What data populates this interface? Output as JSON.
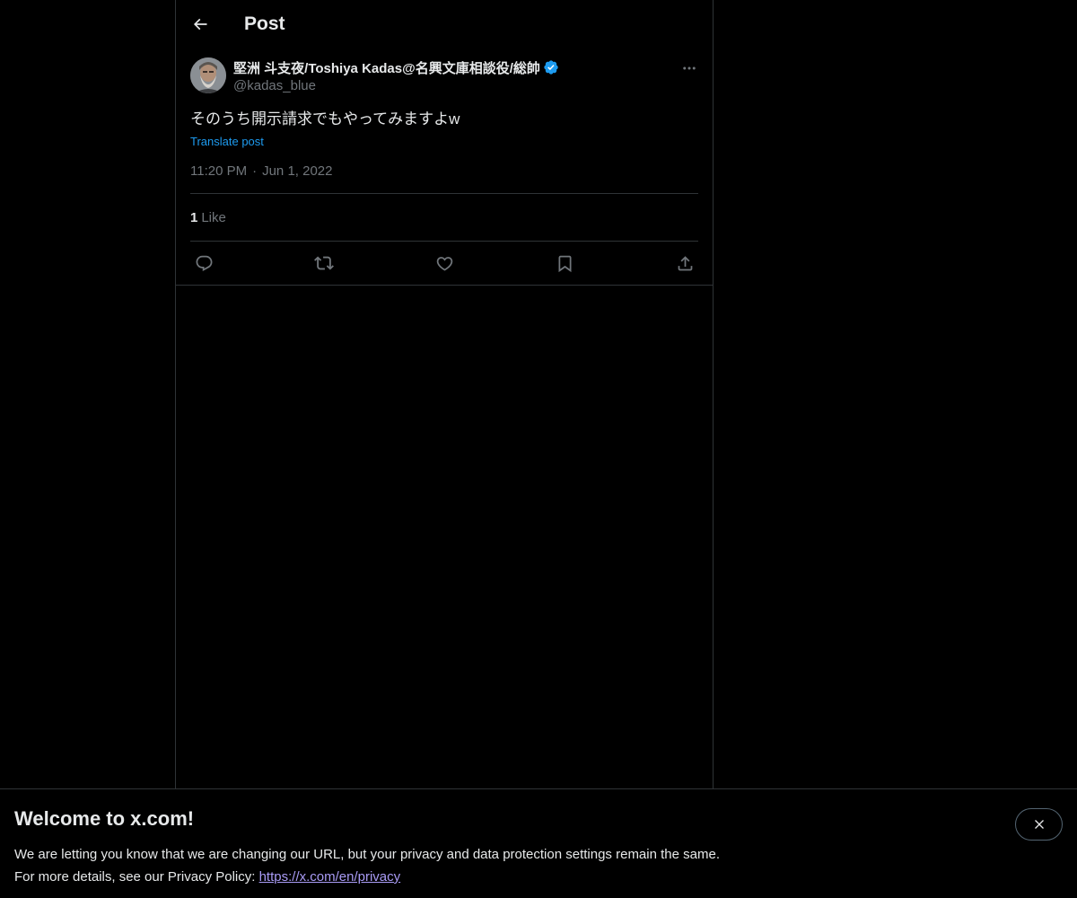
{
  "header": {
    "title": "Post"
  },
  "post": {
    "display_name": "堅洲 斗支夜/Toshiya Kadas@名興文庫相談役/総帥",
    "handle": "@kadas_blue",
    "text": "そのうち開示請求でもやってみますよw",
    "translate_label": "Translate post",
    "time": "11:20 PM",
    "separator": "·",
    "date": "Jun 1, 2022",
    "like_count": "1",
    "like_label": "Like",
    "verified_color": "#1d9bf0"
  },
  "banner": {
    "title": "Welcome to x.com!",
    "line1": "We are letting you know that we are changing our URL, but your privacy and data protection settings remain the same.",
    "line2_prefix": "For more details, see our Privacy Policy: ",
    "link": "https://x.com/en/privacy"
  },
  "icons": {
    "back": "arrow-left-icon",
    "more": "more-horizontal-icon",
    "reply": "reply-icon",
    "repost": "repost-icon",
    "like": "heart-icon",
    "bookmark": "bookmark-icon",
    "share": "share-icon",
    "close": "close-icon"
  },
  "colors": {
    "background": "#000000",
    "text": "#e7e9ea",
    "muted": "#71767b",
    "accent": "#1d9bf0",
    "link": "#a99bf5",
    "border": "#2f3336"
  }
}
